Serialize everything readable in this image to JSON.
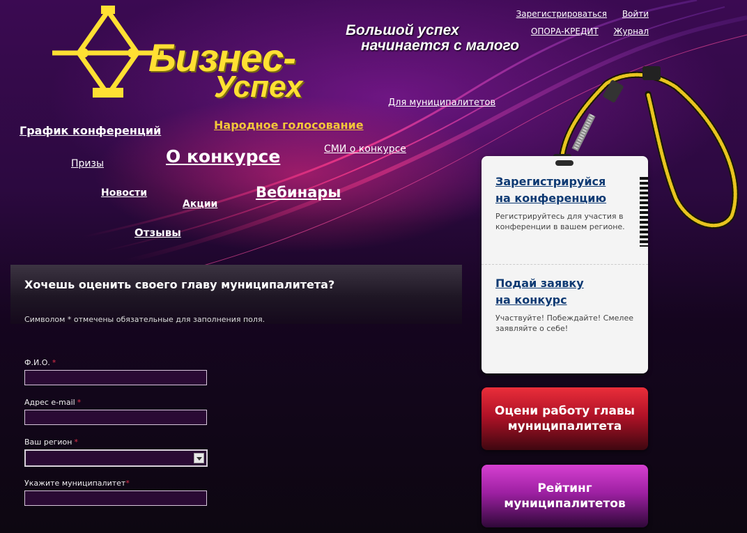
{
  "logo": {
    "line1": "Бизнес-",
    "line2": "Успех"
  },
  "slogan": {
    "line1": "Большой успех",
    "line2": "начинается с малого"
  },
  "top_links": [
    {
      "label": "Зарегистрироваться"
    },
    {
      "label": "Войти"
    },
    {
      "label": "ОПОРА-КРЕДИТ"
    },
    {
      "label": "Журнал"
    }
  ],
  "nav": {
    "grafik": "График конференций",
    "golosovanie": "Народное голосование",
    "municipalitety": "Для муниципалитетов",
    "o_konkurse": "О конкурсе",
    "smi": "СМИ о конкурсе",
    "prizy": "Призы",
    "novosti": "Новости",
    "akcii": "Акции",
    "vebinary": "Вебинары",
    "otzyvy": "Отзывы"
  },
  "form": {
    "title": "Хочешь оценить своего главу муниципалитета?",
    "note": "Символом * отмечены обязательные для заполнения поля.",
    "fields": [
      {
        "label": "Ф.И.О.",
        "required": "*",
        "value": ""
      },
      {
        "label": "Адрес e-mail",
        "required": "*",
        "value": ""
      },
      {
        "label": "Ваш регион",
        "required": "*",
        "value": ""
      },
      {
        "label": "Укажите муниципалитет",
        "required": "*",
        "value": ""
      }
    ]
  },
  "badge": {
    "section1": {
      "link_line1": "Зарегистрируйся",
      "link_line2": "на конференцию",
      "desc": "Регистрируйтесь для участия в конференции в вашем регионе."
    },
    "section2": {
      "link_line1": "Подай заявку",
      "link_line2": "на конкурс",
      "desc": "Участвуйте! Побеждайте! Смелее заявляйте о себе!"
    }
  },
  "buttons": {
    "rate_line1": "Оцени работу главы",
    "rate_line2": "муниципалитета",
    "rating_line1": "Рейтинг",
    "rating_line2": "муниципалитетов"
  },
  "colors": {
    "gold": "#ffe033",
    "accent_link": "#f3c63a",
    "badge_link": "#0e3a73",
    "btn_red": "#b11227",
    "btn_purple": "#9d20a2"
  }
}
